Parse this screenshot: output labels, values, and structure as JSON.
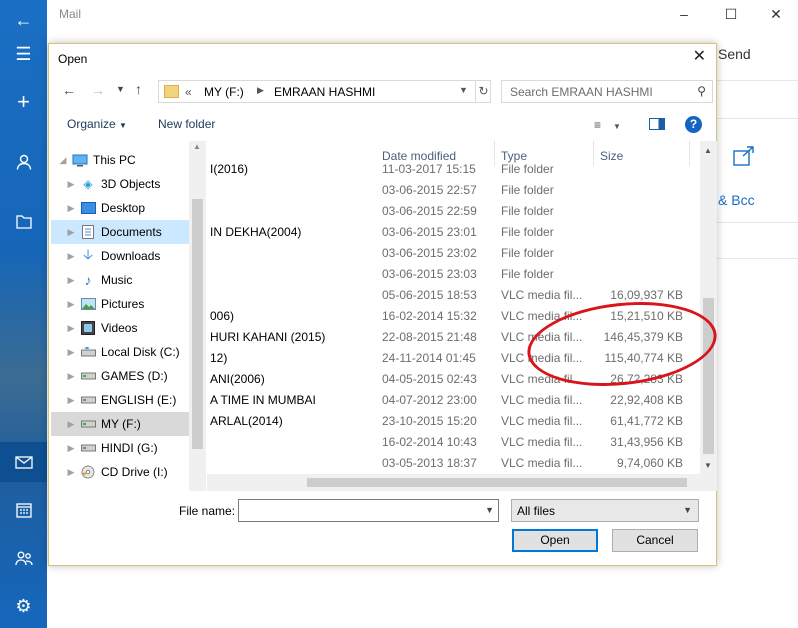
{
  "app": {
    "title": "Mail",
    "send_label": "Send",
    "cc_bcc_label": "& Bcc"
  },
  "dialog": {
    "title": "Open",
    "breadcrumb_prefix": "«",
    "breadcrumb": [
      "MY (F:)",
      "EMRAAN HASHMI"
    ],
    "search_placeholder": "Search EMRAAN HASHMI",
    "organize_label": "Organize",
    "new_folder_label": "New folder",
    "tree": [
      {
        "label": "This PC",
        "icon": "pc-icon"
      },
      {
        "label": "3D Objects",
        "icon": "3d-objects-icon"
      },
      {
        "label": "Desktop",
        "icon": "desktop-icon"
      },
      {
        "label": "Documents",
        "icon": "documents-icon"
      },
      {
        "label": "Downloads",
        "icon": "downloads-icon"
      },
      {
        "label": "Music",
        "icon": "music-icon"
      },
      {
        "label": "Pictures",
        "icon": "pictures-icon"
      },
      {
        "label": "Videos",
        "icon": "videos-icon"
      },
      {
        "label": "Local Disk (C:)",
        "icon": "drive-icon"
      },
      {
        "label": "GAMES (D:)",
        "icon": "drive-icon"
      },
      {
        "label": "ENGLISH (E:)",
        "icon": "drive-icon"
      },
      {
        "label": "MY (F:)",
        "icon": "drive-icon"
      },
      {
        "label": "HINDI (G:)",
        "icon": "drive-icon"
      },
      {
        "label": "CD Drive (I:)",
        "icon": "cd-drive-icon"
      }
    ],
    "columns": [
      "Date modified",
      "Type",
      "Size"
    ],
    "files": [
      {
        "name": "I(2016)",
        "date": "11-03-2017 15:15",
        "type": "File folder",
        "size": ""
      },
      {
        "name": "",
        "date": "03-06-2015 22:57",
        "type": "File folder",
        "size": ""
      },
      {
        "name": "",
        "date": "03-06-2015 22:59",
        "type": "File folder",
        "size": ""
      },
      {
        "name": "IN DEKHA(2004)",
        "date": "03-06-2015 23:01",
        "type": "File folder",
        "size": ""
      },
      {
        "name": "",
        "date": "03-06-2015 23:02",
        "type": "File folder",
        "size": ""
      },
      {
        "name": "",
        "date": "03-06-2015 23:03",
        "type": "File folder",
        "size": ""
      },
      {
        "name": "",
        "date": "05-06-2015 18:53",
        "type": "VLC media fil...",
        "size": "16,09,937 KB"
      },
      {
        "name": "006)",
        "date": "16-02-2014 15:32",
        "type": "VLC media fil...",
        "size": "15,21,510 KB"
      },
      {
        "name": "HURI KAHANI (2015)",
        "date": "22-08-2015 21:48",
        "type": "VLC media fil...",
        "size": "146,45,379 KB"
      },
      {
        "name": "12)",
        "date": "24-11-2014 01:45",
        "type": "VLC media fil...",
        "size": "115,40,774 KB"
      },
      {
        "name": "ANI(2006)",
        "date": "04-05-2015 02:43",
        "type": "VLC media fil...",
        "size": "26,72,283 KB"
      },
      {
        "name": "A TIME IN  MUMBAI",
        "date": "04-07-2012 23:00",
        "type": "VLC media fil...",
        "size": "22,92,408 KB"
      },
      {
        "name": "ARLAL(2014)",
        "date": "23-10-2015 15:20",
        "type": "VLC media fil...",
        "size": "61,41,772 KB"
      },
      {
        "name": "",
        "date": "16-02-2014 10:43",
        "type": "VLC media fil...",
        "size": "31,43,956 KB"
      },
      {
        "name": "",
        "date": "03-05-2013 18:37",
        "type": "VLC media fil...",
        "size": "9,74,060 KB"
      }
    ],
    "file_name_label": "File name:",
    "file_name_value": "",
    "file_type_value": "All files",
    "open_label": "Open",
    "cancel_label": "Cancel"
  },
  "colors": {
    "accent": "#0078d7",
    "annotation": "#d9141b",
    "nav_bg": "#1a6fc4"
  }
}
